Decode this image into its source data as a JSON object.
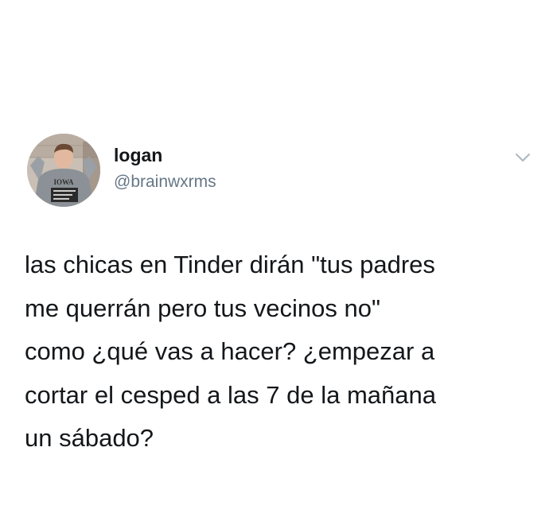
{
  "tweet": {
    "author": {
      "name": "logan",
      "handle": "@brainwxrms",
      "avatar_shirt_text": "IOWA"
    },
    "text": "las chicas en Tinder dirán \"tus padres\nme querrán pero tus vecinos no\"\ncomo ¿qué vas a hacer? ¿empezar a\ncortar el cesped a las 7 de la mañana\nun sábado?",
    "menu_icon": "chevron-down-icon"
  },
  "colors": {
    "text_primary": "#14171a",
    "text_secondary": "#657786",
    "icon": "#aab8c2",
    "background": "#ffffff"
  }
}
